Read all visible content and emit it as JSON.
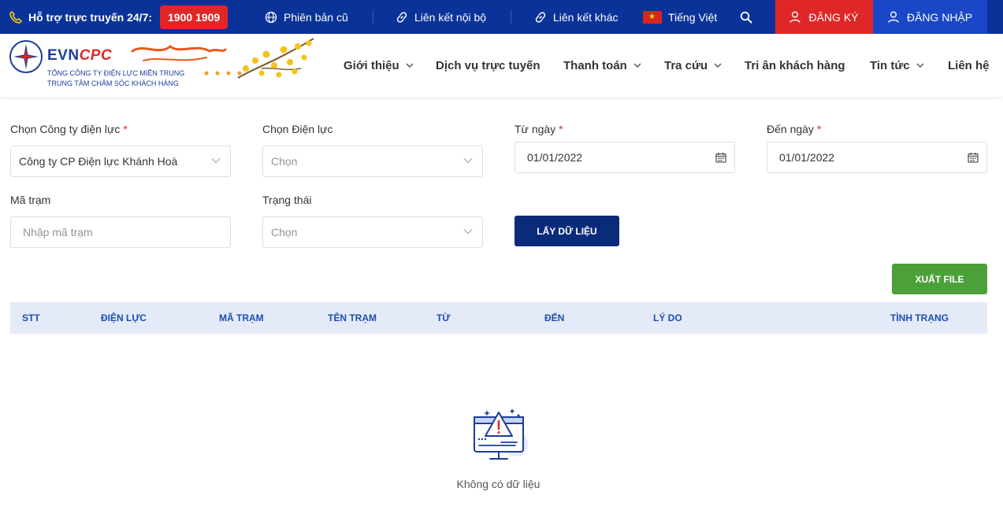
{
  "topbar": {
    "support_label": "Hỗ trợ trực truyến 24/7:",
    "hotline": "1900 1909",
    "links": [
      {
        "label": "Phiên bản cũ",
        "icon": "globe-icon"
      },
      {
        "label": "Liên kết nội bộ",
        "icon": "link-icon"
      },
      {
        "label": "Liên kết khác",
        "icon": "link-icon"
      }
    ],
    "language": "Tiếng Việt",
    "register": "ĐĂNG KÝ",
    "login": "ĐĂNG NHẬP",
    "colors": {
      "bar": "#0a3399",
      "hotline": "#e02727",
      "register": "#e02727",
      "login": "#1a47c7"
    }
  },
  "header": {
    "logo_evn": "EVN",
    "logo_cpc": "CPC",
    "logo_sub1": "TỔNG CÔNG TY ĐIỆN LỰC MIỀN TRUNG",
    "logo_sub2": "TRUNG TÂM CHĂM SÓC KHÁCH HÀNG",
    "nav": [
      {
        "label": "Giới thiệu",
        "dropdown": true
      },
      {
        "label": "Dịch vụ trực tuyến",
        "dropdown": false
      },
      {
        "label": "Thanh toán",
        "dropdown": true
      },
      {
        "label": "Tra cứu",
        "dropdown": true
      },
      {
        "label": "Tri ân khách hàng",
        "dropdown": false
      },
      {
        "label": "Tin tức",
        "dropdown": true
      },
      {
        "label": "Liên hệ",
        "dropdown": false
      }
    ]
  },
  "form": {
    "company_label": "Chọn Công ty điện lực",
    "company_value": "Công ty CP Điện lực Khánh Hoà",
    "unit_label": "Chọn Điện lực",
    "unit_value": "Chọn",
    "from_label": "Từ ngày",
    "from_value": "01/01/2022",
    "to_label": "Đến ngày",
    "to_value": "01/01/2022",
    "station_label": "Mã trạm",
    "station_placeholder": "Nhập mã trạm",
    "status_label": "Trạng thái",
    "status_value": "Chọn",
    "fetch_button": "LẤY DỮ LIỆU",
    "export_button": "XUẤT FILE",
    "required_mark": "*"
  },
  "table": {
    "columns": [
      "STT",
      "ĐIỆN LỰC",
      "MÃ TRẠM",
      "TÊN TRẠM",
      "TỪ",
      "ĐẾN",
      "LÝ DO",
      "TÌNH TRẠNG"
    ],
    "empty_text": "Không có dữ liệu"
  }
}
